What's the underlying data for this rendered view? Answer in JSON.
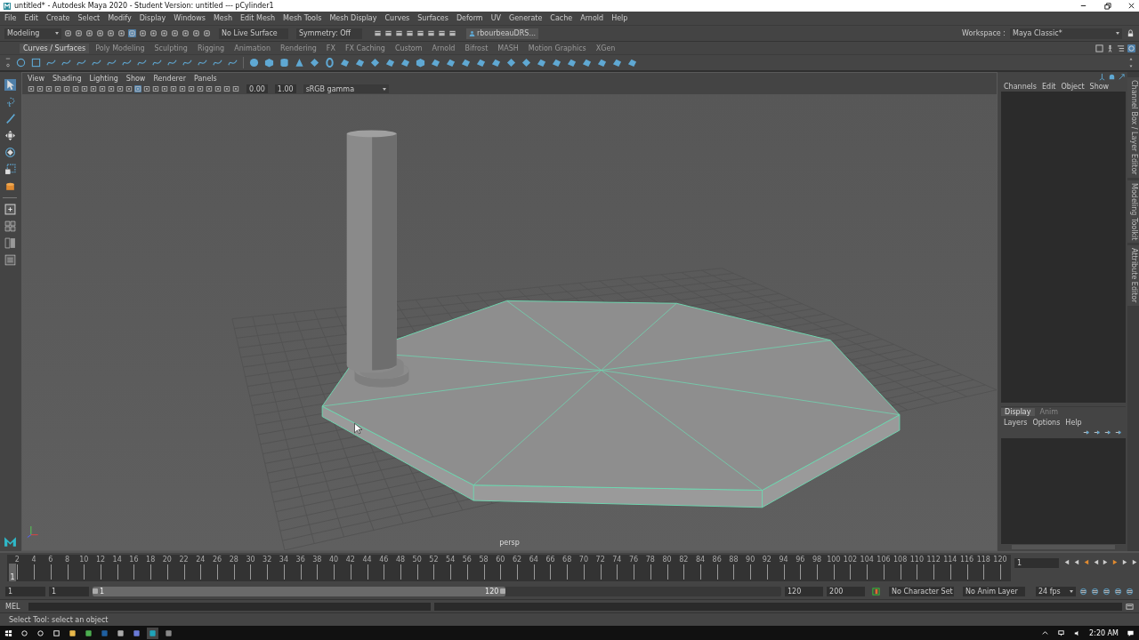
{
  "window": {
    "title": "untitled* - Autodesk Maya 2020 - Student Version: untitled  ---  pCylinder1"
  },
  "menu": [
    "File",
    "Edit",
    "Create",
    "Select",
    "Modify",
    "Display",
    "Windows",
    "Mesh",
    "Edit Mesh",
    "Mesh Tools",
    "Mesh Display",
    "Curves",
    "Surfaces",
    "Deform",
    "UV",
    "Generate",
    "Cache",
    "Arnold",
    "Help"
  ],
  "status_line": {
    "mode": "Modeling",
    "live_surface": "No Live Surface",
    "symmetry": "Symmetry: Off",
    "user": "rbourbeauDRS...",
    "workspace_label": "Workspace :",
    "workspace": "Maya Classic*"
  },
  "shelf": {
    "tabs": [
      {
        "label": "Curves / Surfaces",
        "selected": true
      },
      {
        "label": "Poly Modeling",
        "selected": false
      },
      {
        "label": "Sculpting",
        "selected": false
      },
      {
        "label": "Rigging",
        "selected": false
      },
      {
        "label": "Animation",
        "selected": false
      },
      {
        "label": "Rendering",
        "selected": false
      },
      {
        "label": "FX",
        "selected": false
      },
      {
        "label": "FX Caching",
        "selected": false
      },
      {
        "label": "Custom",
        "selected": false
      },
      {
        "label": "Arnold",
        "selected": false
      },
      {
        "label": "Bifrost",
        "selected": false
      },
      {
        "label": "MASH",
        "selected": false
      },
      {
        "label": "Motion Graphics",
        "selected": false
      },
      {
        "label": "XGen",
        "selected": false
      }
    ]
  },
  "toolbox": [
    {
      "kind": "select",
      "selected": true
    },
    {
      "kind": "lasso",
      "selected": false
    },
    {
      "kind": "paint",
      "selected": false
    },
    {
      "kind": "move",
      "selected": false
    },
    {
      "kind": "rotate",
      "selected": false
    },
    {
      "kind": "scale",
      "selected": false
    }
  ],
  "viewport": {
    "menu": [
      "View",
      "Shading",
      "Lighting",
      "Show",
      "Renderer",
      "Panels"
    ],
    "exposure": "0.00",
    "gamma": "1.00",
    "color_space": "sRGB gamma",
    "camera": "persp"
  },
  "channel_box": {
    "menu": [
      "Channels",
      "Edit",
      "Object",
      "Show"
    ]
  },
  "side_tabs": [
    "Channel Box / Layer Editor",
    "Modeling Toolkit",
    "Attribute Editor"
  ],
  "layer_editor": {
    "tabs": [
      {
        "label": "Display",
        "selected": true
      },
      {
        "label": "Anim",
        "selected": false
      }
    ],
    "menu": [
      "Layers",
      "Options",
      "Help"
    ]
  },
  "timeline": {
    "ticks": [
      "2",
      "4",
      "6",
      "8",
      "10",
      "12",
      "14",
      "16",
      "18",
      "20",
      "22",
      "24",
      "26",
      "28",
      "30",
      "32",
      "34",
      "36",
      "38",
      "40",
      "42",
      "44",
      "46",
      "48",
      "50",
      "52",
      "54",
      "56",
      "58",
      "60",
      "62",
      "64",
      "66",
      "68",
      "70",
      "72",
      "74",
      "76",
      "78",
      "80",
      "82",
      "84",
      "86",
      "88",
      "90",
      "92",
      "94",
      "96",
      "98",
      "100",
      "102",
      "104",
      "106",
      "108",
      "110",
      "112",
      "114",
      "116",
      "118",
      "120"
    ],
    "current_marker": "1",
    "level": 0,
    "current_frame": "1"
  },
  "range": {
    "start": "1",
    "playback_start": "1",
    "slider_start": "1",
    "slider_end": "120",
    "level": 0.6,
    "playback_end": "120",
    "end": "200",
    "character_set": "No Character Set",
    "anim_layer": "No Anim Layer",
    "fps": "24 fps"
  },
  "command_line": {
    "label": "MEL"
  },
  "help_line": "Select Tool: select an object",
  "taskbar": {
    "time": "2:20 AM"
  }
}
